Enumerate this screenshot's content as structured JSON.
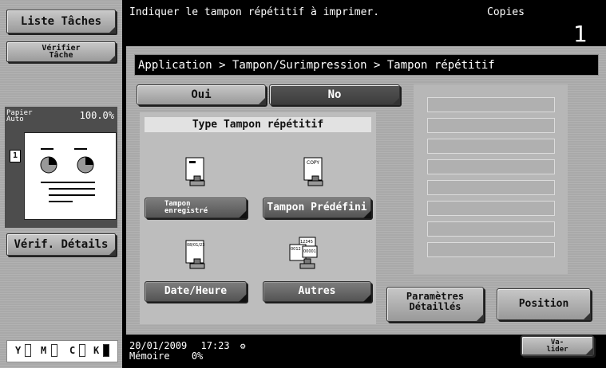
{
  "left_panel": {
    "liste_taches": "Liste Tâches",
    "verifier_tache_1": "Vérifier",
    "verifier_tache_2": "Tâche",
    "paper_label_1": "Papier",
    "paper_label_2": "Auto",
    "zoom": "100.0%",
    "page_number_badge": "1",
    "verif_details": "Vérif. Détails"
  },
  "top_bar": {
    "message": "Indiquer le tampon répétitif à imprimer.",
    "copies_label": "Copies",
    "copies_value": "1"
  },
  "breadcrumb": "Application > Tampon/Surimpression > Tampon répétitif",
  "toggle": {
    "oui": "Oui",
    "no": "No"
  },
  "stamp_type": {
    "title": "Type Tampon répétitif",
    "registered_1": "Tampon",
    "registered_2": "enregistré",
    "predefined": "Tampon Prédéfini",
    "date_time": "Date/Heure",
    "others": "Autres",
    "icon_copy_text": "COPY",
    "icon_date_text": "08/01/23",
    "icon_number_1": "12345",
    "icon_number_2": "0012",
    "icon_number_3": "00001"
  },
  "actions": {
    "parametres_1": "Paramètres",
    "parametres_2": "Détaillés",
    "position": "Position",
    "valider_1": "Va-",
    "valider_2": "lider"
  },
  "status": {
    "date": "20/01/2009",
    "time": "17:23",
    "memory_label": "Mémoire",
    "memory_value": "0%"
  },
  "toner": [
    "Y",
    "M",
    "C",
    "K"
  ],
  "colors": {
    "panel_gray": "#a9a9a9",
    "bar_black": "#000000",
    "selected_dark": "#545454"
  }
}
